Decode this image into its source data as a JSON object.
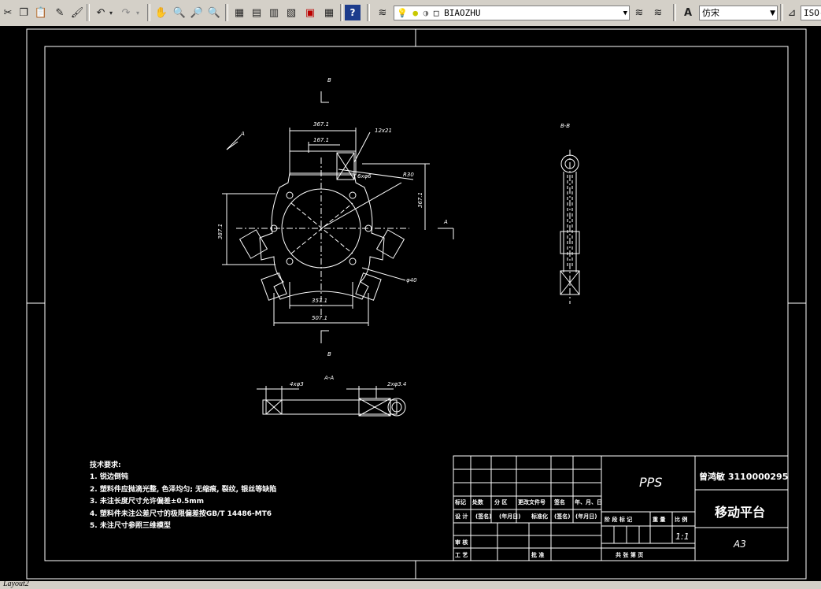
{
  "toolbar": {
    "layer_name": "BIAOZHU",
    "text_style": "仿宋",
    "dim_style": "ISO-"
  },
  "drawing": {
    "labels": {
      "section_b_top": "B",
      "section_b_bottom": "B",
      "view_a": "A",
      "view_a_right": "A",
      "section_bb": "B-B",
      "section_aa": "A-A"
    },
    "dims": {
      "d_top1": "367.1",
      "d_top2": "167.1",
      "d_chamfer": "12x21",
      "d_holes": "6xφ6",
      "d_r30": "R30",
      "d_right": "367.1",
      "d_left": "387.1",
      "d_phi40": "φ40",
      "d_bottom1": "357.1",
      "d_bottom2": "507.1",
      "aa_left": "4xφ3",
      "aa_right": "2xφ3.4"
    },
    "notes": {
      "title": "技术要求:",
      "lines": [
        "1. 锐边倒钝",
        "2. 塑料件应抛滴光整, 色泽均匀; 无缩痕, 裂纹, 银丝等缺陷",
        "3. 未注长度尺寸允许偏差±0.5mm",
        "4. 塑料件未注公差尺寸的极限偏差按GB/T 14486-MT6",
        "5. 未注尺寸参照三维模型"
      ]
    },
    "title_block": {
      "material": "PPS",
      "designer_id": "曾鸿敏 3110000295",
      "part_name": "移动平台",
      "scale": "1:1",
      "sheet": "A3",
      "row_labels": [
        "标记",
        "处数",
        "分 区",
        "更改文件号",
        "签名",
        "年、月、日"
      ],
      "row2_labels": [
        "设 计",
        "(签名)",
        "(年月日)",
        "标准化",
        "(签名)",
        "(年月日)"
      ],
      "stage_labels": [
        "阶 段 标 记",
        "重 量",
        "比 例"
      ],
      "check": "审 核",
      "process": "工 艺",
      "approve": "批 准",
      "sheets_total": "共   张   第   页"
    }
  },
  "status": {
    "tab": "Layout2"
  }
}
